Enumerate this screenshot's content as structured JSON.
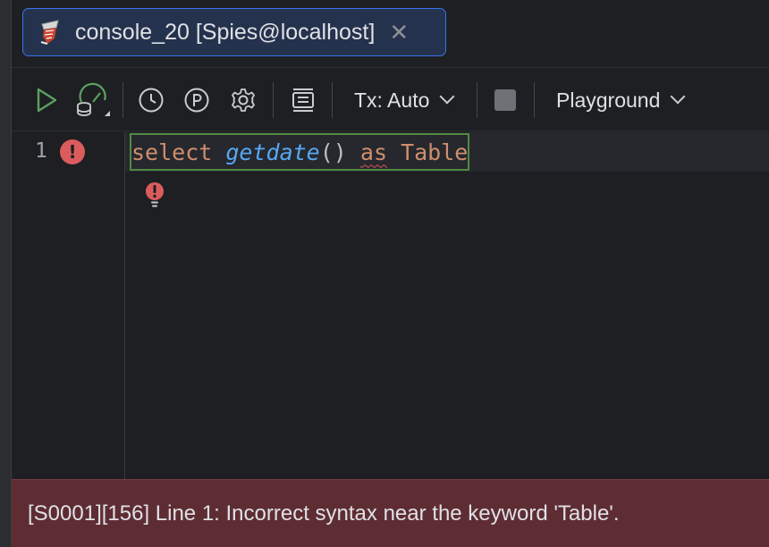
{
  "tab": {
    "title": "console_20 [Spies@localhost]",
    "icon": "sql-server-icon",
    "close_glyph": "✕"
  },
  "toolbar": {
    "tx_label": "Tx: Auto",
    "playground_label": "Playground"
  },
  "editor": {
    "line_number": "1",
    "code": {
      "kw_select": "select",
      "fn_getdate": "getdate",
      "parens": "()",
      "kw_as": "as",
      "ident_table": "Table"
    }
  },
  "error": {
    "message": "[S0001][156] Line 1: Incorrect syntax near the keyword 'Table'."
  },
  "colors": {
    "accent": "#3574f0",
    "run_green": "#5aa15f",
    "error_red": "#db5c5c",
    "error_bar": "#5e2d33",
    "keyword": "#cf8e6d",
    "function": "#56a8f5"
  }
}
